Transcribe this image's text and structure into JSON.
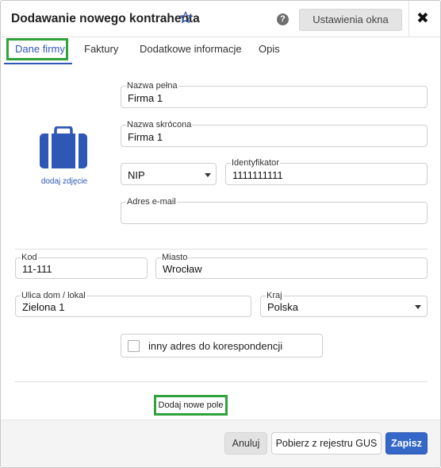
{
  "header": {
    "title": "Dodawanie nowego kontrahenta",
    "settings_label": "Ustawienia okna",
    "help_glyph": "?",
    "close_glyph": "✖"
  },
  "tabs": [
    {
      "label": "Dane firmy",
      "active": true
    },
    {
      "label": "Faktury",
      "active": false
    },
    {
      "label": "Dodatkowe informacje",
      "active": false
    },
    {
      "label": "Opis",
      "active": false
    }
  ],
  "photo": {
    "icon": "briefcase-icon",
    "link_label": "dodaj zdjęcie"
  },
  "form": {
    "full_name": {
      "label": "Nazwa pełna",
      "value": "Firma 1"
    },
    "short_name": {
      "label": "Nazwa skrócona",
      "value": "Firma 1"
    },
    "id_type": {
      "value": "NIP"
    },
    "identifier": {
      "label": "Identyfikator",
      "value": "1111111111"
    },
    "email": {
      "label": "Adres e-mail",
      "value": ""
    },
    "postal_code": {
      "label": "Kod",
      "value": "11-111"
    },
    "city": {
      "label": "Miasto",
      "value": "Wrocław"
    },
    "street": {
      "label": "Ulica dom / lokal",
      "value": "Zielona 1"
    },
    "country": {
      "label": "Kraj",
      "value": "Polska"
    },
    "alt_address": {
      "label": "inny adres do korespondencji",
      "checked": false
    }
  },
  "add_field_label": "Dodaj nowe pole",
  "footer": {
    "cancel_label": "Anuluj",
    "gus_label": "Pobierz z rejestru GUS",
    "save_label": "Zapisz"
  },
  "colors": {
    "accent": "#2f58b6",
    "highlight": "#2fa23c",
    "primary_button": "#3467c8"
  }
}
